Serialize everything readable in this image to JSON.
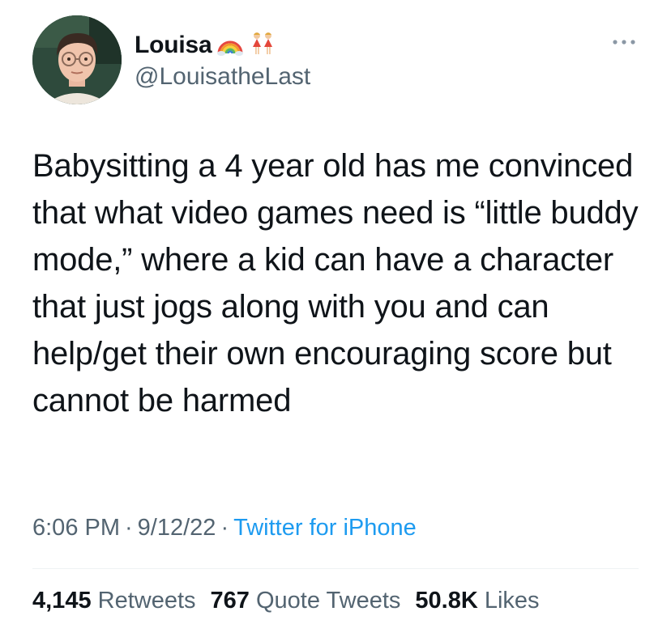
{
  "author": {
    "display_name": "Louisa",
    "handle": "@LouisatheLast",
    "name_emojis": [
      "rainbow-icon",
      "two-women-icon"
    ]
  },
  "tweet": {
    "text": "Babysitting a 4 year old has me convinced that what video games need is “little buddy mode,” where a kid can have a character that just jogs along with you and can help/get their own encouraging score but cannot be harmed"
  },
  "meta": {
    "time": "6:06 PM",
    "separator": "·",
    "date": "9/12/22",
    "source": "Twitter for iPhone"
  },
  "stats": {
    "retweets_count": "4,145",
    "retweets_label": "Retweets",
    "quotes_count": "767",
    "quotes_label": "Quote Tweets",
    "likes_count": "50.8K",
    "likes_label": "Likes"
  },
  "colors": {
    "text": "#0f1419",
    "secondary": "#536471",
    "link": "#1d9bf0",
    "divider": "#eff3f4"
  }
}
